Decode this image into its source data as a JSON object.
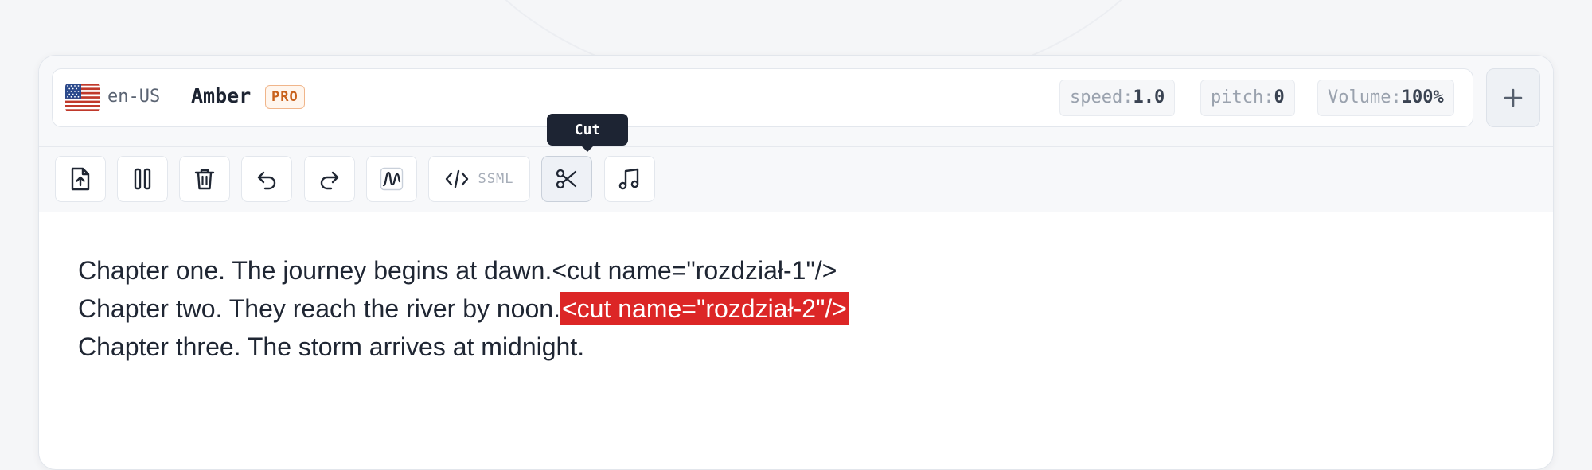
{
  "voice_bar": {
    "language_code": "en-US",
    "voice_name": "Amber",
    "badge": "PRO",
    "params": [
      {
        "label": "speed:",
        "value": "1.0"
      },
      {
        "label": "pitch:",
        "value": "0"
      },
      {
        "label": "Volume:",
        "value": "100%"
      }
    ],
    "add_button_icon": "plus-icon"
  },
  "toolbar": {
    "buttons": [
      {
        "icon": "file-upload-icon"
      },
      {
        "icon": "pause-icon"
      },
      {
        "icon": "trash-icon"
      },
      {
        "icon": "undo-icon"
      },
      {
        "icon": "redo-icon"
      },
      {
        "icon": "waveform-icon"
      },
      {
        "icon": "code-icon",
        "label": "SSML"
      },
      {
        "icon": "scissors-icon",
        "active": true
      },
      {
        "icon": "music-note-icon"
      }
    ],
    "tooltip": "Cut"
  },
  "editor": {
    "lines": [
      {
        "text": "Chapter one. The journey begins at dawn.",
        "tag": "<cut name=\"rozdział-1\"/>",
        "highlighted": false
      },
      {
        "text": "Chapter two. They reach the river by noon.",
        "tag": "<cut name=\"rozdział-2\"/>",
        "highlighted": true
      },
      {
        "text": "Chapter three. The storm arrives at midnight.",
        "tag": "",
        "highlighted": false
      }
    ]
  },
  "colors": {
    "highlight": "#dc2626",
    "badge_text": "#c8611c",
    "tooltip_bg": "#1d2433"
  }
}
